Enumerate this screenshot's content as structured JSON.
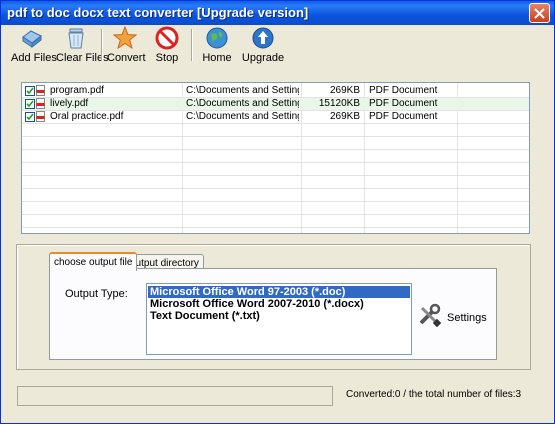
{
  "window": {
    "title": "pdf to doc docx text converter [Upgrade version]"
  },
  "toolbar": {
    "add_files": "Add Files",
    "clear_files": "Clear Files",
    "convert": "Convert",
    "stop": "Stop",
    "home": "Home",
    "upgrade": "Upgrade"
  },
  "files": [
    {
      "checked": true,
      "name": "program.pdf",
      "path": "C:\\Documents and Setting...",
      "size": "269KB",
      "type": "PDF Document"
    },
    {
      "checked": true,
      "name": "lively.pdf",
      "path": "C:\\Documents and Setting...",
      "size": "15120KB",
      "type": "PDF Document"
    },
    {
      "checked": true,
      "name": "Oral practice.pdf",
      "path": "C:\\Documents and Setting...",
      "size": "269KB",
      "type": "PDF Document"
    }
  ],
  "tabs": [
    {
      "label": "choose output file",
      "active": true
    },
    {
      "label": "output directory",
      "active": false
    }
  ],
  "output": {
    "label": "Output Type:",
    "options": [
      "Microsoft Office Word 97-2003 (*.doc)",
      "Microsoft Office Word 2007-2010 (*.docx)",
      "Text Document (*.txt)"
    ],
    "selected_index": 0
  },
  "settings_label": "Settings",
  "status": {
    "text": "Converted:0  /  the total number of files:3",
    "progress": 0
  }
}
